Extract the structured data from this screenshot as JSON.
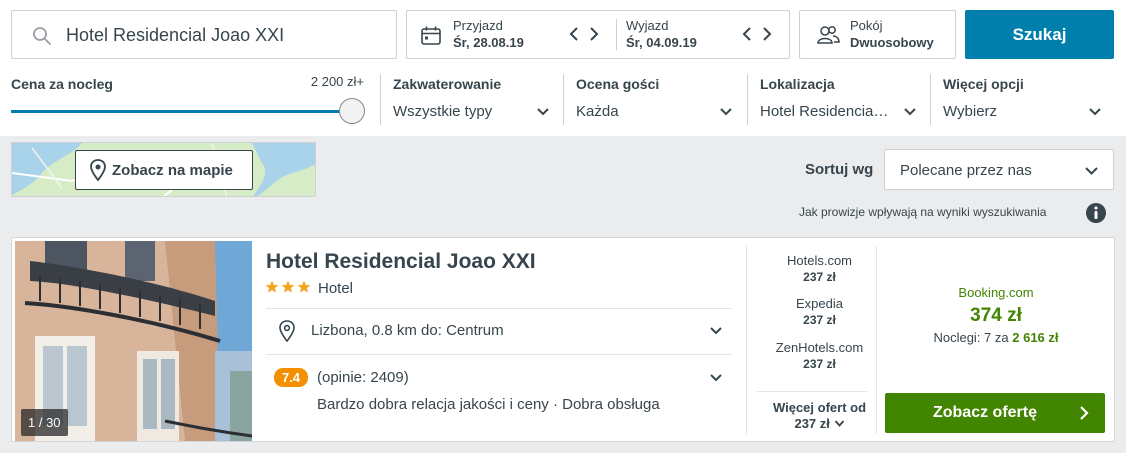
{
  "search": {
    "query": "Hotel Residencial Joao XXI",
    "checkin_label": "Przyjazd",
    "checkin_value": "Śr, 28.08.19",
    "checkout_label": "Wyjazd",
    "checkout_value": "Śr, 04.09.19",
    "rooms_label": "Pokój",
    "rooms_value": "Dwuosobowy",
    "search_button": "Szukaj"
  },
  "filters": {
    "price_label": "Cena za nocleg",
    "price_value": "2 200 zł+",
    "price_fraction": 1.0,
    "accommodation_label": "Zakwaterowanie",
    "accommodation_value": "Wszystkie typy",
    "rating_label": "Ocena gości",
    "rating_value": "Każda",
    "location_label": "Lokalizacja",
    "location_value": "Hotel Residencia…",
    "more_label": "Więcej opcji",
    "more_value": "Wybierz"
  },
  "map": {
    "button_label": "Zobacz na mapie"
  },
  "sort": {
    "label": "Sortuj wg",
    "value": "Polecane przez nas",
    "commission_note": "Jak prowizje wpływają na wyniki wyszukiwania"
  },
  "result": {
    "photo_counter": "1 / 30",
    "name": "Hotel Residencial Joao XXI",
    "stars": 3,
    "type": "Hotel",
    "location": "Lizbona, 0.8 km do: Centrum",
    "rating": "7.4",
    "reviews": "(opinie: 2409)",
    "rating_desc": "Bardzo dobra relacja jakości i ceny · Dobra obsługa",
    "offers": [
      {
        "provider": "Hotels.com",
        "price": "237 zł"
      },
      {
        "provider": "Expedia",
        "price": "237 zł"
      },
      {
        "provider": "ZenHotels.com",
        "price": "237 zł"
      }
    ],
    "more_offers_line1": "Więcej ofert od",
    "more_offers_line2": "237 zł",
    "best_provider": "Booking.com",
    "best_price": "374 zł",
    "nights_prefix": "Noclegi: 7 za",
    "nights_total": "2 616 zł",
    "deal_button": "Zobacz ofertę"
  },
  "colors": {
    "accent_blue": "#007fad",
    "deal_green": "#428500",
    "rating_orange": "#f48f00",
    "star_orange": "#f4a41d"
  }
}
